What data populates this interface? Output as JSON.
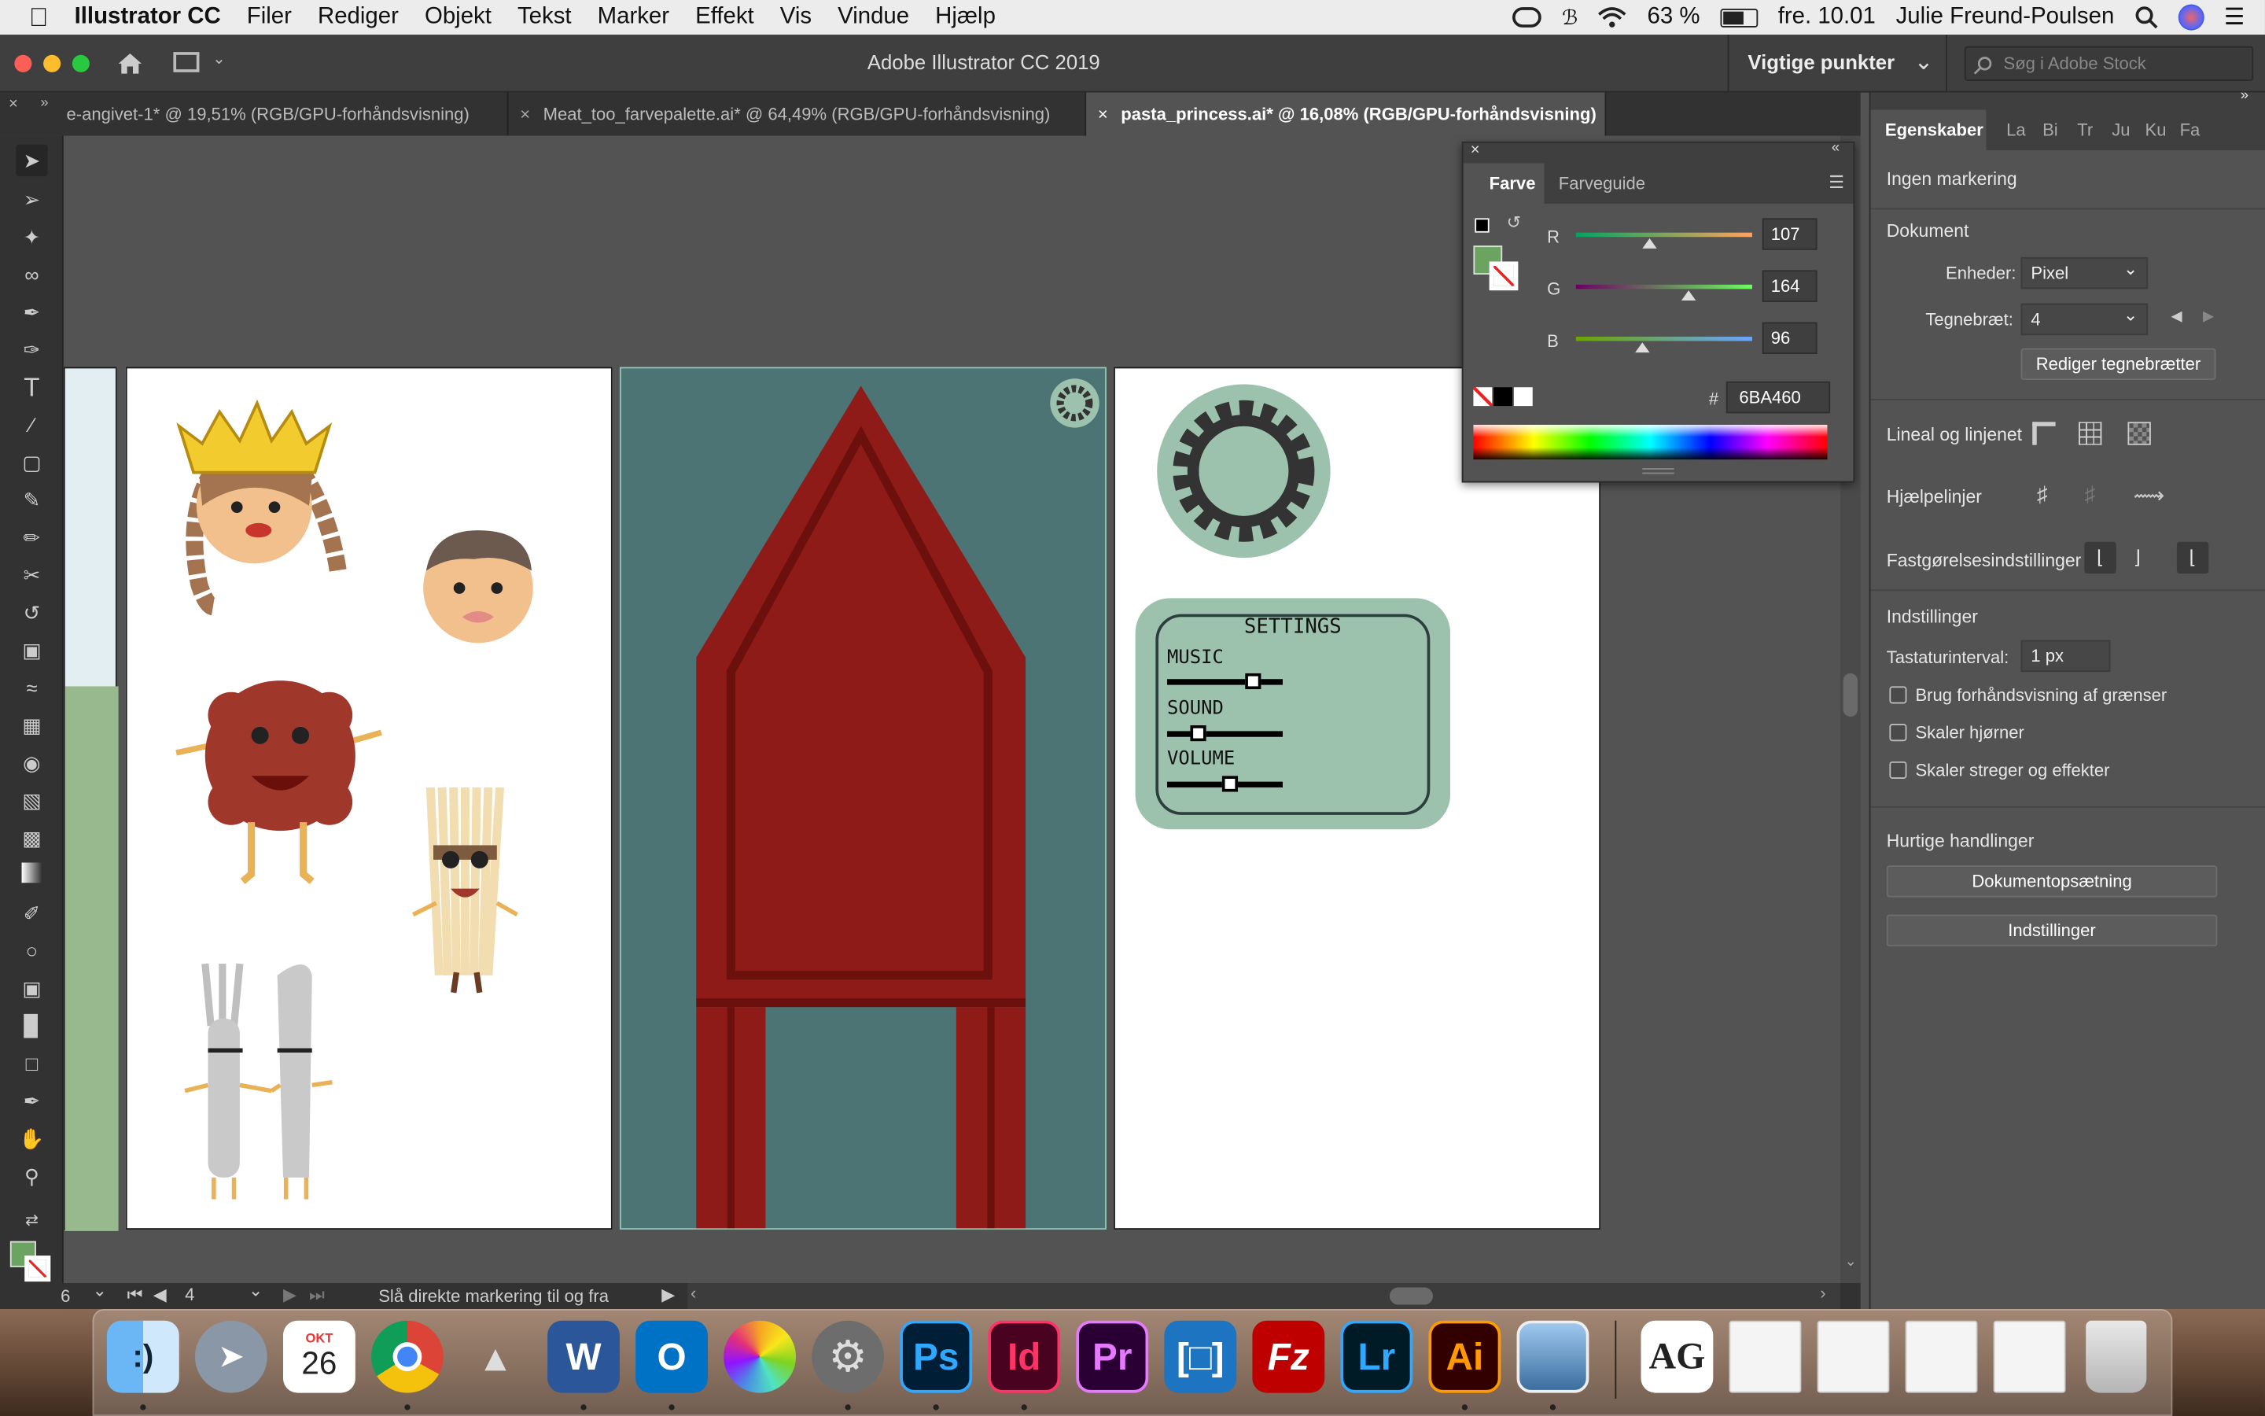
{
  "menubar": {
    "app_name": "Illustrator CC",
    "items": [
      "Filer",
      "Rediger",
      "Objekt",
      "Tekst",
      "Marker",
      "Effekt",
      "Vis",
      "Vindue",
      "Hjælp"
    ],
    "battery": "63 %",
    "date": "fre. 10.01",
    "user": "Julie Freund-Poulsen"
  },
  "window": {
    "title": "Adobe Illustrator CC 2019",
    "workspace": "Vigtige punkter",
    "stock_search_placeholder": "Søg i Adobe Stock"
  },
  "doc_tabs": [
    {
      "label": "e-angivet-1* @ 19,51% (RGB/GPU-forhåndsvisning)",
      "active": false
    },
    {
      "label": "Meat_too_farvepalette.ai* @ 64,49% (RGB/GPU-forhåndsvisning)",
      "active": false
    },
    {
      "label": "pasta_princess.ai* @ 16,08% (RGB/GPU-forhåndsvisning)",
      "active": true
    }
  ],
  "color_panel": {
    "tabs": [
      "Farve",
      "Farveguide"
    ],
    "r_label": "R",
    "g_label": "G",
    "b_label": "B",
    "r": "107",
    "g": "164",
    "b": "96",
    "r_value": 107,
    "g_value": 164,
    "b_value": 96,
    "hex_label": "#",
    "hex": "6BA460",
    "fill_color": "#6BA460"
  },
  "properties_panel": {
    "tabs": [
      "Egenskaber",
      "La",
      "Bi",
      "Tr",
      "Ju",
      "Ku",
      "Fa"
    ],
    "no_selection": "Ingen markering",
    "document_title": "Dokument",
    "units_label": "Enheder:",
    "units_value": "Pixel",
    "artboard_label": "Tegnebræt:",
    "artboard_value": "4",
    "edit_artboards_button": "Rediger tegnebrætter",
    "rulers_label": "Lineal og linjenet",
    "guides_label": "Hjælpelinjer",
    "snap_label": "Fastgørelsesindstillinger",
    "settings_title": "Indstillinger",
    "key_increment_label": "Tastaturinterval:",
    "key_increment_value": "1 px",
    "checkbox_preview_bounds": "Brug forhåndsvisning af grænser",
    "checkbox_scale_corners": "Skaler hjørner",
    "checkbox_scale_strokes": "Skaler streger og effekter",
    "quick_actions_title": "Hurtige handlinger",
    "document_setup_button": "Dokumentopsætning",
    "preferences_button": "Indstillinger"
  },
  "statusbar": {
    "zoom_fragment": "6",
    "artboard_number": "4",
    "status_text": "Slå direkte markering til og fra"
  },
  "artwork": {
    "settings_title": "SETTINGS",
    "music_label": "MUSIC",
    "sound_label": "SOUND",
    "volume_label": "VOLUME",
    "music_level": 0.75,
    "sound_level": 0.28,
    "volume_level": 0.57,
    "teal_bg": "#4D7474",
    "red_door": "#8E1B17",
    "mint": "#9CC2AD"
  },
  "dock": {
    "calendar_month": "OKT",
    "calendar_day": "26",
    "apps": [
      "Finder",
      "Launchpad",
      "Kalender",
      "Chrome",
      "Keynote",
      "Word",
      "Outlook",
      "Fotos",
      "Systemindstillinger",
      "Photoshop",
      "InDesign",
      "Premiere Pro",
      "Brackets",
      "FileZilla",
      "Lightroom",
      "Illustrator",
      "Eksempel"
    ],
    "ps": "Ps",
    "id": "Id",
    "pr": "Pr",
    "lr": "Lr",
    "ai": "Ai",
    "fz": "Fz",
    "ag": "AG"
  }
}
